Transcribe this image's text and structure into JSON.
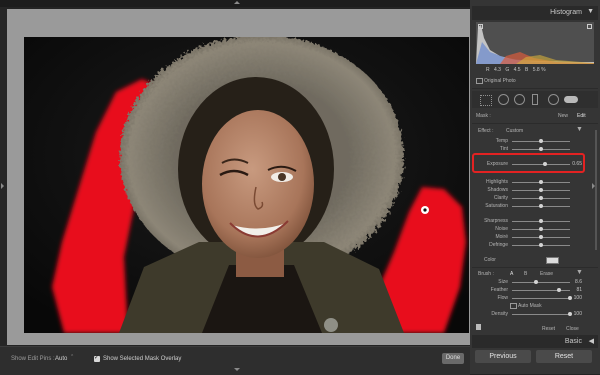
{
  "histogram": {
    "title": "Histogram",
    "readout_r_label": "R",
    "readout_r_value": "4.3",
    "readout_g_label": "G",
    "readout_g_value": "4.5",
    "readout_b_label": "B",
    "readout_b_value": "5.8",
    "readout_unit": "%",
    "original_photo_label": "Original Photo"
  },
  "mask": {
    "label": "Mask :",
    "new_label": "New",
    "edit_label": "Edit",
    "effect_label": "Effect :",
    "effect_value": "Custom"
  },
  "sliders": [
    {
      "label": "Temp",
      "value": "",
      "position": 0.5
    },
    {
      "label": "Tint",
      "value": "",
      "position": 0.5
    },
    {
      "label": "Exposure",
      "value": "0.65",
      "position": 0.57
    },
    {
      "label": "Highlights",
      "value": "",
      "position": 0.5
    },
    {
      "label": "Shadows",
      "value": "",
      "position": 0.5
    },
    {
      "label": "Clarity",
      "value": "",
      "position": 0.5
    },
    {
      "label": "Saturation",
      "value": "",
      "position": 0.5
    },
    {
      "label": "Sharpness",
      "value": "",
      "position": 0.5
    },
    {
      "label": "Noise",
      "value": "",
      "position": 0.5
    },
    {
      "label": "Moiré",
      "value": "",
      "position": 0.5
    },
    {
      "label": "Defringe",
      "value": "",
      "position": 0.5
    }
  ],
  "color_label": "Color",
  "brush": {
    "label": "Brush :",
    "a_label": "A",
    "b_label": "B",
    "erase_label": "Erase",
    "size_label": "Size",
    "size_value": "8.6",
    "size_position": 0.42,
    "feather_label": "Feather",
    "feather_value": "81",
    "feather_position": 0.81,
    "flow_label": "Flow",
    "flow_value": "100",
    "flow_position": 1.0,
    "auto_mask_label": "Auto Mask",
    "density_label": "Density",
    "density_value": "100",
    "density_position": 1.0
  },
  "reset_label": "Reset",
  "close_label": "Close",
  "basic_label": "Basic",
  "previous_label": "Previous",
  "reset_button_label": "Reset",
  "toolbar": {
    "show_edit_pins_label": "Show Edit Pins :",
    "show_edit_pins_value": "Auto",
    "mask_overlay_label": "Show Selected Mask Overlay",
    "done_label": "Done"
  },
  "colors": {
    "mask_overlay": "#e8111a",
    "highlight_box": "#e32222",
    "panel_bg": "#353535"
  }
}
